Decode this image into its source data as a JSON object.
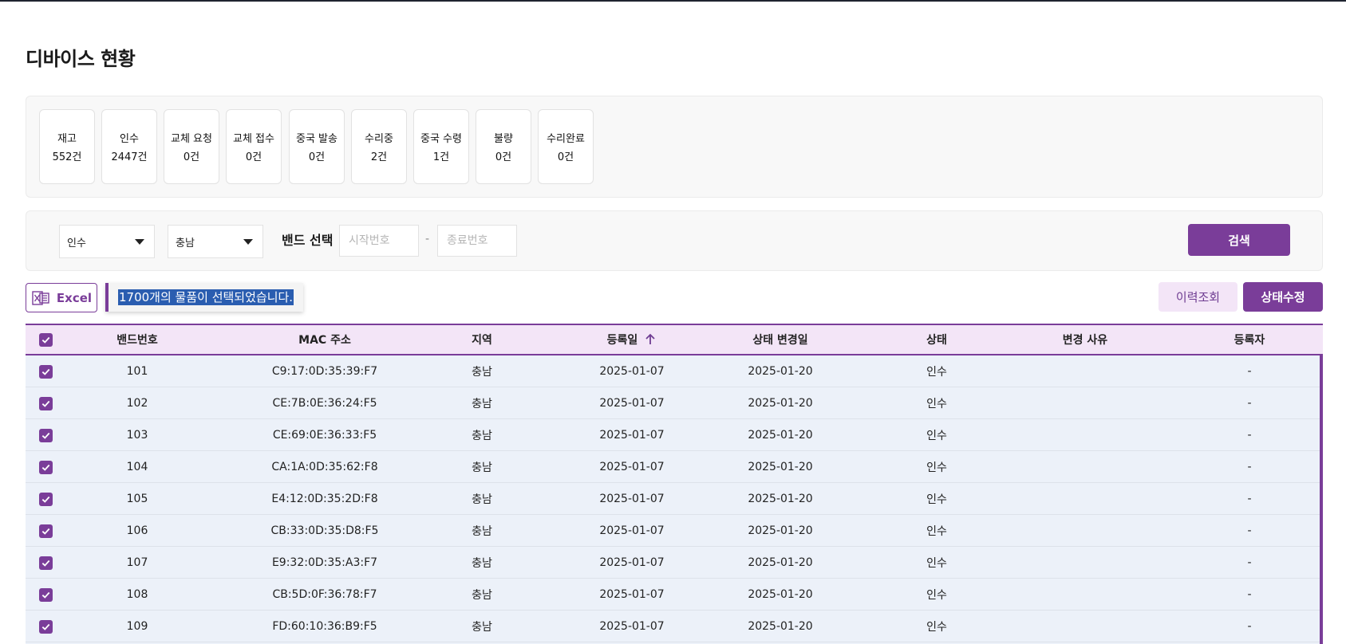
{
  "page": {
    "title": "디바이스 현황"
  },
  "summary": [
    {
      "label": "재고",
      "count": "552건"
    },
    {
      "label": "인수",
      "count": "2447건"
    },
    {
      "label": "교체 요청",
      "count": "0건"
    },
    {
      "label": "교체 접수",
      "count": "0건"
    },
    {
      "label": "중국 발송",
      "count": "0건"
    },
    {
      "label": "수리중",
      "count": "2건"
    },
    {
      "label": "중국 수령",
      "count": "1건"
    },
    {
      "label": "불량",
      "count": "0건"
    },
    {
      "label": "수리완료",
      "count": "0건"
    }
  ],
  "filters": {
    "status_select": "인수",
    "region_select": "충남",
    "band_label": "밴드 선택",
    "start_placeholder": "시작번호",
    "end_placeholder": "종료번호",
    "separator": "-",
    "search_label": "검색"
  },
  "toolbar": {
    "excel_label": "Excel",
    "selection_notice": "1700개의 물품이 선택되었습니다.",
    "history_label": "이력조회",
    "status_edit_label": "상태수정"
  },
  "table": {
    "header_checked": true,
    "columns": [
      "밴드번호",
      "MAC 주소",
      "지역",
      "등록일",
      "상태 변경일",
      "상태",
      "변경 사유",
      "등록자"
    ],
    "sort_column": "등록일",
    "rows": [
      {
        "checked": true,
        "band": "101",
        "mac": "C9:17:0D:35:39:F7",
        "region": "충남",
        "registered": "2025-01-07",
        "changed": "2025-01-20",
        "status": "인수",
        "reason": "",
        "registrar": "-"
      },
      {
        "checked": true,
        "band": "102",
        "mac": "CE:7B:0E:36:24:F5",
        "region": "충남",
        "registered": "2025-01-07",
        "changed": "2025-01-20",
        "status": "인수",
        "reason": "",
        "registrar": "-"
      },
      {
        "checked": true,
        "band": "103",
        "mac": "CE:69:0E:36:33:F5",
        "region": "충남",
        "registered": "2025-01-07",
        "changed": "2025-01-20",
        "status": "인수",
        "reason": "",
        "registrar": "-"
      },
      {
        "checked": true,
        "band": "104",
        "mac": "CA:1A:0D:35:62:F8",
        "region": "충남",
        "registered": "2025-01-07",
        "changed": "2025-01-20",
        "status": "인수",
        "reason": "",
        "registrar": "-"
      },
      {
        "checked": true,
        "band": "105",
        "mac": "E4:12:0D:35:2D:F8",
        "region": "충남",
        "registered": "2025-01-07",
        "changed": "2025-01-20",
        "status": "인수",
        "reason": "",
        "registrar": "-"
      },
      {
        "checked": true,
        "band": "106",
        "mac": "CB:33:0D:35:D8:F5",
        "region": "충남",
        "registered": "2025-01-07",
        "changed": "2025-01-20",
        "status": "인수",
        "reason": "",
        "registrar": "-"
      },
      {
        "checked": true,
        "band": "107",
        "mac": "E9:32:0D:35:A3:F7",
        "region": "충남",
        "registered": "2025-01-07",
        "changed": "2025-01-20",
        "status": "인수",
        "reason": "",
        "registrar": "-"
      },
      {
        "checked": true,
        "band": "108",
        "mac": "CB:5D:0F:36:78:F7",
        "region": "충남",
        "registered": "2025-01-07",
        "changed": "2025-01-20",
        "status": "인수",
        "reason": "",
        "registrar": "-"
      },
      {
        "checked": true,
        "band": "109",
        "mac": "FD:60:10:36:B9:F5",
        "region": "충남",
        "registered": "2025-01-07",
        "changed": "2025-01-20",
        "status": "인수",
        "reason": "",
        "registrar": "-"
      }
    ]
  },
  "colors": {
    "accent": "#7a3d99",
    "header_bg": "#f3e5f7",
    "row_bg": "#ecf1f9",
    "selection_highlight": "#2a5db0"
  },
  "icons": {
    "excel": "excel-file-icon",
    "sort": "arrow-up-icon",
    "dropdown": "chevron-down-icon",
    "checkbox": "checkmark-icon"
  }
}
